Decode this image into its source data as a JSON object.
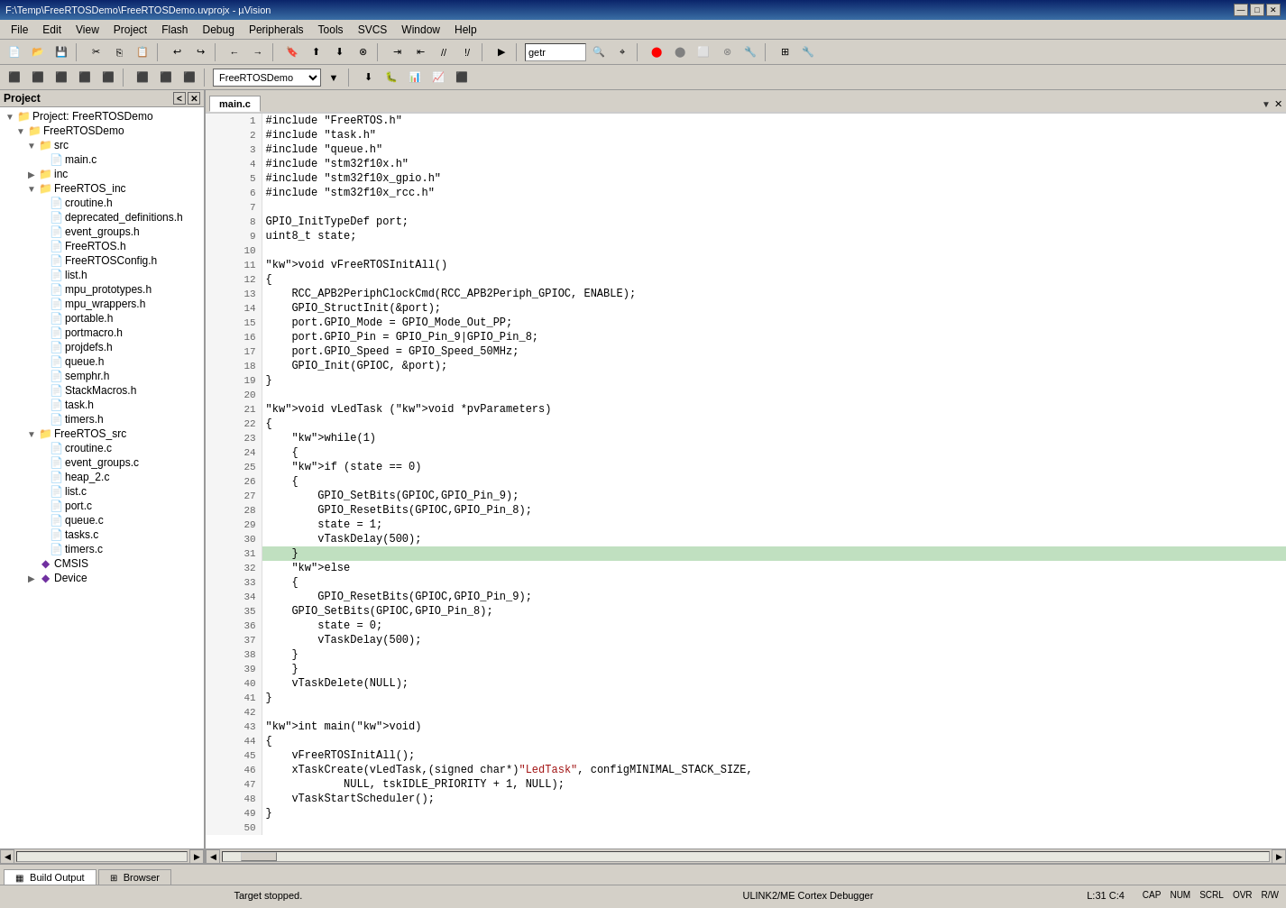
{
  "titlebar": {
    "title": "F:\\Temp\\FreeRTOSDemo\\FreeRTOSDemo.uvprojx - µVision",
    "minimize": "—",
    "maximize": "□",
    "close": "✕"
  },
  "menu": {
    "items": [
      "File",
      "Edit",
      "View",
      "Project",
      "Flash",
      "Debug",
      "Peripherals",
      "Tools",
      "SVCS",
      "Window",
      "Help"
    ]
  },
  "project_panel": {
    "title": "Project",
    "tree": [
      {
        "id": "project-root",
        "label": "Project: FreeRTOSDemo",
        "level": 0,
        "type": "project",
        "expanded": true
      },
      {
        "id": "freeRTOSDemo",
        "label": "FreeRTOSDemo",
        "level": 1,
        "type": "folder",
        "expanded": true
      },
      {
        "id": "src",
        "label": "src",
        "level": 2,
        "type": "folder",
        "expanded": true
      },
      {
        "id": "main-c",
        "label": "main.c",
        "level": 3,
        "type": "c-file"
      },
      {
        "id": "inc",
        "label": "inc",
        "level": 2,
        "type": "folder",
        "expanded": false
      },
      {
        "id": "FreeRTOS-inc",
        "label": "FreeRTOS_inc",
        "level": 2,
        "type": "folder",
        "expanded": true
      },
      {
        "id": "croutine-h",
        "label": "croutine.h",
        "level": 3,
        "type": "h-file"
      },
      {
        "id": "deprecated-h",
        "label": "deprecated_definitions.h",
        "level": 3,
        "type": "h-file"
      },
      {
        "id": "event-groups-h",
        "label": "event_groups.h",
        "level": 3,
        "type": "h-file"
      },
      {
        "id": "FreeRTOS-h",
        "label": "FreeRTOS.h",
        "level": 3,
        "type": "h-file"
      },
      {
        "id": "FreeRTOSConfig-h",
        "label": "FreeRTOSConfig.h",
        "level": 3,
        "type": "h-file"
      },
      {
        "id": "list-h",
        "label": "list.h",
        "level": 3,
        "type": "h-file"
      },
      {
        "id": "mpu-prototypes-h",
        "label": "mpu_prototypes.h",
        "level": 3,
        "type": "h-file"
      },
      {
        "id": "mpu-wrappers-h",
        "label": "mpu_wrappers.h",
        "level": 3,
        "type": "h-file"
      },
      {
        "id": "portable-h",
        "label": "portable.h",
        "level": 3,
        "type": "h-file"
      },
      {
        "id": "portmacro-h",
        "label": "portmacro.h",
        "level": 3,
        "type": "h-file"
      },
      {
        "id": "projdefs-h",
        "label": "projdefs.h",
        "level": 3,
        "type": "h-file"
      },
      {
        "id": "queue-h",
        "label": "queue.h",
        "level": 3,
        "type": "h-file"
      },
      {
        "id": "semphr-h",
        "label": "semphr.h",
        "level": 3,
        "type": "h-file"
      },
      {
        "id": "StackMacros-h",
        "label": "StackMacros.h",
        "level": 3,
        "type": "h-file"
      },
      {
        "id": "task-h",
        "label": "task.h",
        "level": 3,
        "type": "h-file"
      },
      {
        "id": "timers-h",
        "label": "timers.h",
        "level": 3,
        "type": "h-file"
      },
      {
        "id": "FreeRTOS-src",
        "label": "FreeRTOS_src",
        "level": 2,
        "type": "folder",
        "expanded": true
      },
      {
        "id": "croutine-c",
        "label": "croutine.c",
        "level": 3,
        "type": "c-file"
      },
      {
        "id": "event-groups-c",
        "label": "event_groups.c",
        "level": 3,
        "type": "c-file"
      },
      {
        "id": "heap2-c",
        "label": "heap_2.c",
        "level": 3,
        "type": "c-file"
      },
      {
        "id": "list-c",
        "label": "list.c",
        "level": 3,
        "type": "c-file"
      },
      {
        "id": "port-c",
        "label": "port.c",
        "level": 3,
        "type": "c-file"
      },
      {
        "id": "queue-c",
        "label": "queue.c",
        "level": 3,
        "type": "c-file"
      },
      {
        "id": "tasks-c",
        "label": "tasks.c",
        "level": 3,
        "type": "c-file"
      },
      {
        "id": "timers-c",
        "label": "timers.c",
        "level": 3,
        "type": "c-file"
      },
      {
        "id": "cmsis",
        "label": "CMSIS",
        "level": 2,
        "type": "diamond"
      },
      {
        "id": "device",
        "label": "Device",
        "level": 2,
        "type": "diamond-exp"
      }
    ]
  },
  "tab": {
    "name": "main.c"
  },
  "code": {
    "lines": [
      {
        "n": 1,
        "text": "#include \"FreeRTOS.h\""
      },
      {
        "n": 2,
        "text": "#include \"task.h\""
      },
      {
        "n": 3,
        "text": "#include \"queue.h\""
      },
      {
        "n": 4,
        "text": "#include \"stm32f10x.h\""
      },
      {
        "n": 5,
        "text": "#include \"stm32f10x_gpio.h\""
      },
      {
        "n": 6,
        "text": "#include \"stm32f10x_rcc.h\""
      },
      {
        "n": 7,
        "text": ""
      },
      {
        "n": 8,
        "text": "GPIO_InitTypeDef port;"
      },
      {
        "n": 9,
        "text": "uint8_t state;"
      },
      {
        "n": 10,
        "text": ""
      },
      {
        "n": 11,
        "text": "void vFreeRTOSInitAll()"
      },
      {
        "n": 12,
        "text": "{"
      },
      {
        "n": 13,
        "text": "    RCC_APB2PeriphClockCmd(RCC_APB2Periph_GPIOC, ENABLE);"
      },
      {
        "n": 14,
        "text": "    GPIO_StructInit(&port);"
      },
      {
        "n": 15,
        "text": "    port.GPIO_Mode = GPIO_Mode_Out_PP;"
      },
      {
        "n": 16,
        "text": "    port.GPIO_Pin = GPIO_Pin_9|GPIO_Pin_8;"
      },
      {
        "n": 17,
        "text": "    port.GPIO_Speed = GPIO_Speed_50MHz;"
      },
      {
        "n": 18,
        "text": "    GPIO_Init(GPIOC, &port);"
      },
      {
        "n": 19,
        "text": "}"
      },
      {
        "n": 20,
        "text": ""
      },
      {
        "n": 21,
        "text": "void vLedTask (void *pvParameters)"
      },
      {
        "n": 22,
        "text": "{"
      },
      {
        "n": 23,
        "text": "    while(1)"
      },
      {
        "n": 24,
        "text": "    {"
      },
      {
        "n": 25,
        "text": "    if (state == 0)"
      },
      {
        "n": 26,
        "text": "    {"
      },
      {
        "n": 27,
        "text": "        GPIO_SetBits(GPIOC,GPIO_Pin_9);"
      },
      {
        "n": 28,
        "text": "        GPIO_ResetBits(GPIOC,GPIO_Pin_8);"
      },
      {
        "n": 29,
        "text": "        state = 1;"
      },
      {
        "n": 30,
        "text": "        vTaskDelay(500);"
      },
      {
        "n": 31,
        "text": "    }",
        "highlighted": true,
        "cursor": true
      },
      {
        "n": 32,
        "text": "    else"
      },
      {
        "n": 33,
        "text": "    {"
      },
      {
        "n": 34,
        "text": "        GPIO_ResetBits(GPIOC,GPIO_Pin_9);"
      },
      {
        "n": 35,
        "text": "    GPIO_SetBits(GPIOC,GPIO_Pin_8);"
      },
      {
        "n": 36,
        "text": "        state = 0;"
      },
      {
        "n": 37,
        "text": "        vTaskDelay(500);"
      },
      {
        "n": 38,
        "text": "    }"
      },
      {
        "n": 39,
        "text": "    }"
      },
      {
        "n": 40,
        "text": "    vTaskDelete(NULL);"
      },
      {
        "n": 41,
        "text": "}"
      },
      {
        "n": 42,
        "text": ""
      },
      {
        "n": 43,
        "text": "int main(void)"
      },
      {
        "n": 44,
        "text": "{"
      },
      {
        "n": 45,
        "text": "    vFreeRTOSInitAll();"
      },
      {
        "n": 46,
        "text": "    xTaskCreate(vLedTask,(signed char*)\"LedTask\", configMINIMAL_STACK_SIZE,"
      },
      {
        "n": 47,
        "text": "            NULL, tskIDLE_PRIORITY + 1, NULL);"
      },
      {
        "n": 48,
        "text": "    vTaskStartScheduler();"
      },
      {
        "n": 49,
        "text": "}"
      },
      {
        "n": 50,
        "text": ""
      }
    ]
  },
  "bottom_tabs": [
    {
      "label": "Build Output",
      "icon": "▦"
    },
    {
      "label": "Browser",
      "icon": "⊞"
    }
  ],
  "statusbar": {
    "target": "Target stopped.",
    "ulink": "ULINK2/ME Cortex Debugger",
    "position": "L:31 C:4",
    "indicators": [
      "CAP",
      "NUM",
      "SCRL",
      "OVR",
      "R/W"
    ]
  },
  "toolbar_search": {
    "value": "getr",
    "placeholder": "getr"
  },
  "toolbar2_target": {
    "value": "FreeRTOSDemo"
  }
}
